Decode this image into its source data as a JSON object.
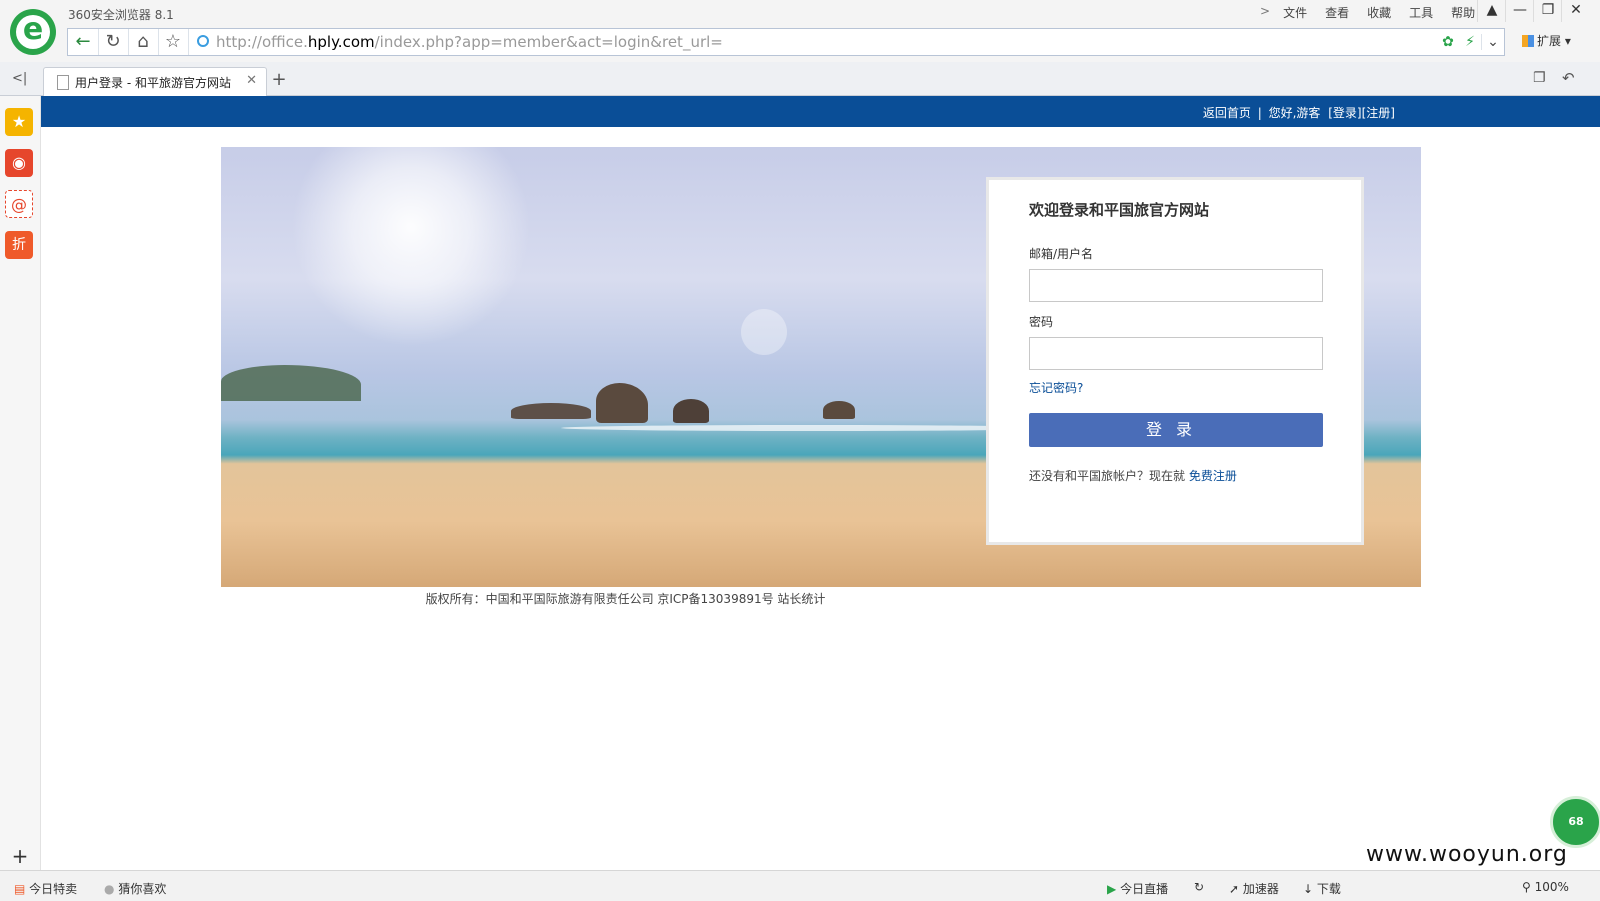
{
  "browser": {
    "title": "360安全浏览器 8.1",
    "menu": [
      "文件",
      "查看",
      "收藏",
      "工具",
      "帮助"
    ],
    "menu_chevron": ">",
    "url_scheme": "http://office.",
    "url_host": "hply.com",
    "url_path": "/index.php?app=member&act=login&ret_url=",
    "extensions_label": "扩展",
    "tab_title": "用户登录 - 和平旅游官方网站"
  },
  "sidebar": {
    "items": [
      {
        "icon": "star-icon",
        "color": "#f5b400"
      },
      {
        "icon": "weibo-icon",
        "color": "#e6462c"
      },
      {
        "icon": "mail-icon",
        "color": "#e6462c"
      },
      {
        "icon": "discount-icon",
        "color": "#ef5a2a"
      }
    ],
    "mail_glyph": "@",
    "discount_glyph": "折"
  },
  "site": {
    "nav": {
      "home": "返回首页",
      "separator": "|",
      "greeting": "您好,游客",
      "login": "[登录]",
      "register": "[注册]"
    },
    "login": {
      "heading": "欢迎登录和平国旅官方网站",
      "username_label": "邮箱/用户名",
      "password_label": "密码",
      "forgot": "忘记密码?",
      "submit": "登录",
      "no_account": "还没有和平国旅帐户？现在就",
      "register_link": "免费注册"
    },
    "footer": "版权所有：中国和平国际旅游有限责任公司 京ICP备13039891号 站长统计"
  },
  "badge": "68",
  "statusbar": {
    "left": [
      "今日特卖",
      "猜你喜欢"
    ],
    "right": [
      "今日直播",
      "加速器",
      "下载"
    ],
    "zoom": "100%"
  },
  "watermark": "www.wooyun.org",
  "colors": {
    "brand_blue": "#0a4e97",
    "login_button": "#4a6db8",
    "browser_green": "#2aa44a"
  }
}
